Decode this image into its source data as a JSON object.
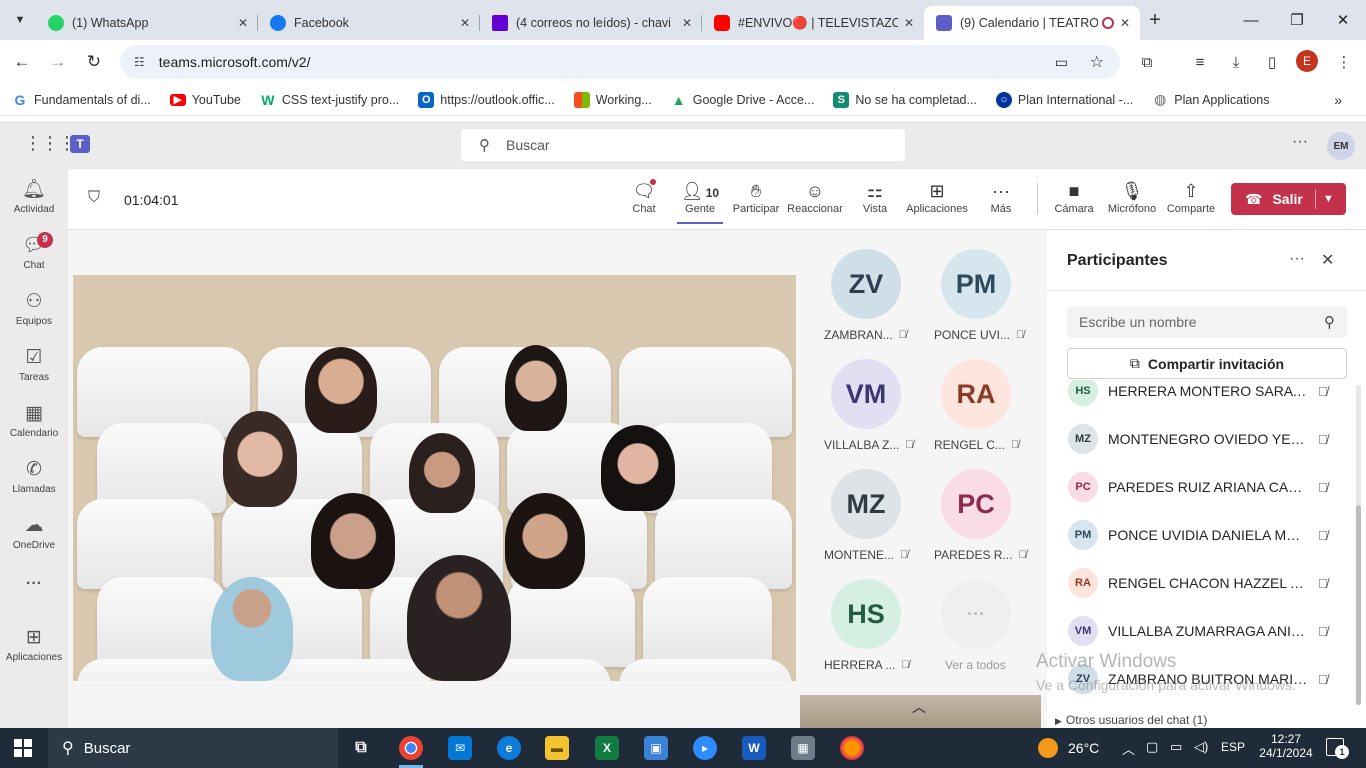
{
  "browser": {
    "tabs": [
      {
        "title": "(1) WhatsApp",
        "icon": "whatsapp-icon",
        "color": "#25d366"
      },
      {
        "title": "Facebook",
        "icon": "facebook-icon",
        "color": "#1877f2"
      },
      {
        "title": "(4 correos no leídos) - chavi",
        "icon": "yahoo-mail-icon",
        "color": "#6001d2"
      },
      {
        "title": "#ENVIVO🔴 | TELEVISTAZO",
        "icon": "youtube-icon",
        "color": "#ff0000"
      },
      {
        "title": "(9) Calendario | TEATRO",
        "icon": "teams-icon",
        "color": "#5b5fc7"
      }
    ],
    "url": "teams.microsoft.com/v2/",
    "profile_initial": "E",
    "bookmarks": [
      {
        "label": "Fundamentals of di...",
        "icon": "google-icon",
        "color": "#4285f4"
      },
      {
        "label": "YouTube",
        "icon": "youtube-icon",
        "color": "#ff0000"
      },
      {
        "label": "CSS text-justify pro...",
        "icon": "w3schools-icon",
        "color": "#04aa6d"
      },
      {
        "label": "https://outlook.offic...",
        "icon": "outlook-icon",
        "color": "#0a64c8"
      },
      {
        "label": "Working...",
        "icon": "microsoft-icon",
        "color": "#f25022"
      },
      {
        "label": "Google Drive - Acce...",
        "icon": "google-drive-icon",
        "color": "#1fa463"
      },
      {
        "label": "No se ha completad...",
        "icon": "sway-icon",
        "color": "#138a72"
      },
      {
        "label": "Plan International -...",
        "icon": "plan-icon",
        "color": "#0033a0"
      },
      {
        "label": "Plan Applications",
        "icon": "globe-icon",
        "color": "#5f6368"
      }
    ]
  },
  "teams": {
    "search_placeholder": "Buscar",
    "user_initials": "EM",
    "rail": [
      {
        "label": "Actividad",
        "icon": "bell-icon"
      },
      {
        "label": "Chat",
        "icon": "chat-icon",
        "badge": "9"
      },
      {
        "label": "Equipos",
        "icon": "teams-group-icon"
      },
      {
        "label": "Tareas",
        "icon": "tasks-icon"
      },
      {
        "label": "Calendario",
        "icon": "calendar-icon"
      },
      {
        "label": "Llamadas",
        "icon": "phone-icon"
      },
      {
        "label": "OneDrive",
        "icon": "cloud-icon"
      },
      {
        "label": "",
        "icon": "more-icon"
      },
      {
        "label": "Aplicaciones",
        "icon": "add-apps-icon"
      }
    ],
    "meeting": {
      "timer": "01:04:01",
      "people_count": "10",
      "buttons": [
        {
          "label": "Chat",
          "icon": "chat-icon"
        },
        {
          "label": "Gente",
          "icon": "people-icon"
        },
        {
          "label": "Participar",
          "icon": "raise-hand-icon"
        },
        {
          "label": "Reaccionar",
          "icon": "smile-icon"
        },
        {
          "label": "Vista",
          "icon": "grid-view-icon"
        },
        {
          "label": "Aplicaciones",
          "icon": "add-icon"
        },
        {
          "label": "Más",
          "icon": "more-icon"
        },
        {
          "label": "Cámara",
          "icon": "camera-icon"
        },
        {
          "label": "Micrófono",
          "icon": "mic-icon"
        },
        {
          "label": "Comparte",
          "icon": "share-icon"
        }
      ],
      "leave_label": "Salir"
    },
    "tiles": [
      {
        "initials": "ZV",
        "name": "ZAMBRAN...",
        "bg": "#cfdfe8",
        "fg": "#2c3e50"
      },
      {
        "initials": "PM",
        "name": "PONCE UVI...",
        "bg": "#d6e6ee",
        "fg": "#304a5a"
      },
      {
        "initials": "VM",
        "name": "VILLALBA Z...",
        "bg": "#e3dff2",
        "fg": "#3c3770"
      },
      {
        "initials": "RA",
        "name": "RENGEL C...",
        "bg": "#fde5dd",
        "fg": "#8a3a25"
      },
      {
        "initials": "MZ",
        "name": "MONTENE...",
        "bg": "#dde3e6",
        "fg": "#2f3b40"
      },
      {
        "initials": "PC",
        "name": "PAREDES R...",
        "bg": "#f9dce6",
        "fg": "#8d2a4f"
      },
      {
        "initials": "HS",
        "name": "HERRERA ...",
        "bg": "#d5efe3",
        "fg": "#245c42"
      }
    ],
    "see_all_label": "Ver a todos",
    "panel": {
      "title": "Participantes",
      "search_placeholder": "Escribe un nombre",
      "invite_label": "Compartir invitación",
      "participants": [
        {
          "initials": "HS",
          "name": "HERRERA MONTERO SARA SO...",
          "bg": "#d5efe3",
          "fg": "#245c42"
        },
        {
          "initials": "MZ",
          "name": "MONTENEGRO OVIEDO YELAR...",
          "bg": "#dde3e6",
          "fg": "#2f3b40"
        },
        {
          "initials": "PC",
          "name": "PAREDES RUIZ ARIANA CAMILA",
          "bg": "#f9dce6",
          "fg": "#8d2a4f"
        },
        {
          "initials": "PM",
          "name": "PONCE UVIDIA DANIELA MAYTE",
          "bg": "#d6e6ee",
          "fg": "#304a5a"
        },
        {
          "initials": "RA",
          "name": "RENGEL CHACON HAZZEL AN...",
          "bg": "#fde5dd",
          "fg": "#8a3a25"
        },
        {
          "initials": "VM",
          "name": "VILLALBA ZUMARRAGA ANITA...",
          "bg": "#e3dff2",
          "fg": "#3c3770"
        },
        {
          "initials": "ZV",
          "name": "ZAMBRANO BUITRON MARIA ...",
          "bg": "#cfdfe8",
          "fg": "#2c3e50"
        }
      ],
      "other_users_label": "Otros usuarios del chat (1)"
    }
  },
  "watermark": {
    "line1": "Activar Windows",
    "line2": "Ve a Configuración para activar Windows."
  },
  "taskbar": {
    "search_label": "Buscar",
    "weather": "26°C",
    "language": "ESP",
    "time": "12:27",
    "date": "24/1/2024",
    "notification_count": "1"
  }
}
